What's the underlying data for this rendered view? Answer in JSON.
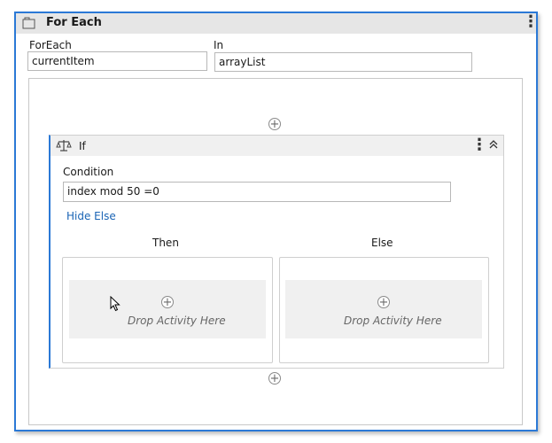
{
  "foreach": {
    "title": "For Each",
    "foreach_label": "ForEach",
    "item_value": "currentItem",
    "in_label": "In",
    "in_value": "arrayList",
    "menu_glyph": "⋮"
  },
  "body": {
    "add_glyph": "+"
  },
  "if_activity": {
    "title": "If",
    "menu_glyph": "⋮",
    "collapse_glyph": "⌃",
    "condition_label": "Condition",
    "condition_value": "index mod 50 =0",
    "hide_else": "Hide Else",
    "then_label": "Then",
    "else_label": "Else",
    "then_drop": "Drop Activity Here",
    "else_drop": "Drop Activity Here"
  },
  "colors": {
    "accent": "#2b79d6",
    "link": "#1a64b5",
    "header_bg": "#e6e6e6",
    "drop_zone_bg": "#f0f0f0"
  },
  "icons": {
    "foreach": "foreach-activity-icon",
    "if": "if-scale-icon",
    "add": "add-circle-icon",
    "menu": "kebab-menu-icon",
    "collapse": "collapse-chevron-icon",
    "cursor": "mouse-cursor-icon"
  }
}
